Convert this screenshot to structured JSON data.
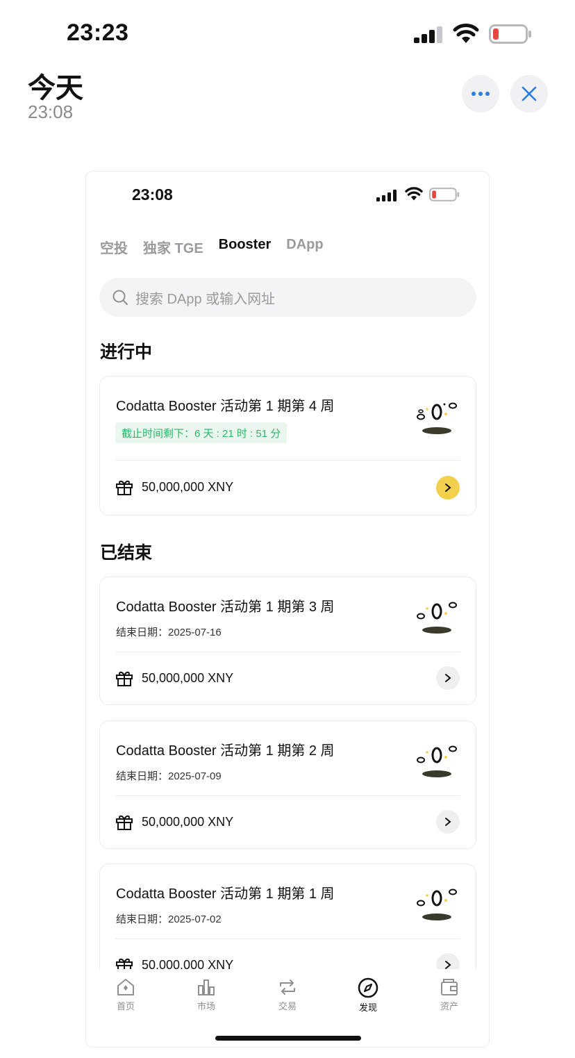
{
  "status_outer": {
    "time": "23:23"
  },
  "header": {
    "title": "今天",
    "subtitle": "23:08"
  },
  "status_inner": {
    "time": "23:08"
  },
  "tabs": [
    {
      "label": "空投",
      "active": false
    },
    {
      "label": "独家 TGE",
      "active": false
    },
    {
      "label": "Booster",
      "active": true
    },
    {
      "label": "DApp",
      "active": false
    }
  ],
  "search": {
    "placeholder": "搜索 DApp 或输入网址"
  },
  "ongoing": {
    "title": "进行中",
    "cards": [
      {
        "title": "Codatta Booster 活动第 1 期第 4 周",
        "countdown": "截止时间剩下：6 天 : 21 时 : 51 分",
        "reward": "50,000,000 XNY"
      }
    ]
  },
  "ended": {
    "title": "已结束",
    "cards": [
      {
        "title": "Codatta Booster 活动第 1 期第 3 周",
        "end_date": "结束日期：2025-07-16",
        "reward": "50,000,000 XNY"
      },
      {
        "title": "Codatta Booster 活动第 1 期第 2 周",
        "end_date": "结束日期：2025-07-09",
        "reward": "50,000,000 XNY"
      },
      {
        "title": "Codatta Booster 活动第 1 期第 1 周",
        "end_date": "结束日期：2025-07-02",
        "reward": "50,000,000 XNY"
      }
    ]
  },
  "tabbar": [
    {
      "label": "首页",
      "icon": "home-icon",
      "active": false
    },
    {
      "label": "市场",
      "icon": "market-icon",
      "active": false
    },
    {
      "label": "交易",
      "icon": "trade-icon",
      "active": false
    },
    {
      "label": "发现",
      "icon": "discover-icon",
      "active": true
    },
    {
      "label": "资产",
      "icon": "wallet-icon",
      "active": false
    }
  ],
  "colors": {
    "accent_yellow": "#f3d04b",
    "countdown_green": "#2fb56a",
    "close_blue": "#2a7de1",
    "battery_red": "#e5483f"
  }
}
